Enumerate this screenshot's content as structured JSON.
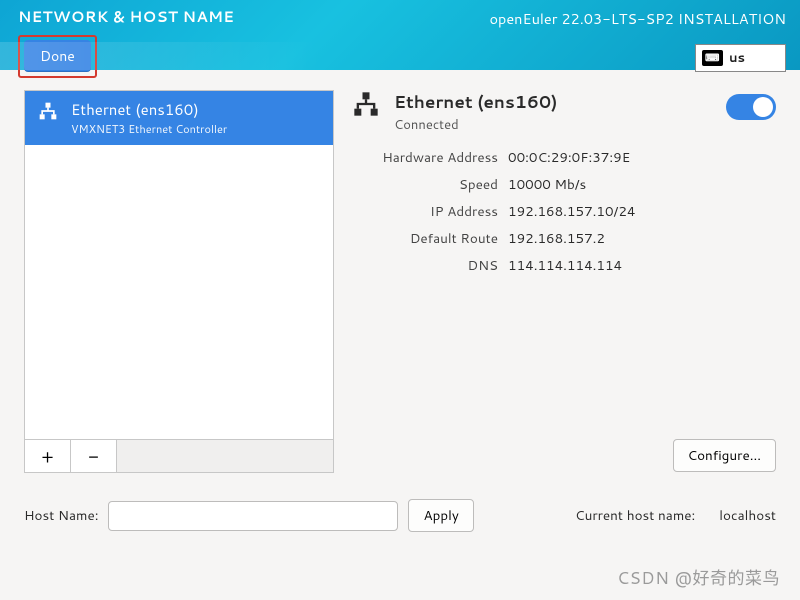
{
  "header": {
    "screen_title": "NETWORK & HOST NAME",
    "install_title": "openEuler 22.03-LTS-SP2 INSTALLATION",
    "done_label": "Done",
    "keyboard_layout": "us"
  },
  "devices": [
    {
      "name": "Ethernet (ens160)",
      "subtitle": "VMXNET3 Ethernet Controller"
    }
  ],
  "list_buttons": {
    "add": "+",
    "remove": "−"
  },
  "connection": {
    "title": "Ethernet (ens160)",
    "status": "Connected",
    "toggle_on": true
  },
  "details": {
    "labels": {
      "hwaddr": "Hardware Address",
      "speed": "Speed",
      "ip": "IP Address",
      "route": "Default Route",
      "dns": "DNS"
    },
    "values": {
      "hwaddr": "00:0C:29:0F:37:9E",
      "speed": "10000 Mb/s",
      "ip": "192.168.157.10/24",
      "route": "192.168.157.2",
      "dns": "114.114.114.114"
    }
  },
  "buttons": {
    "configure": "Configure...",
    "apply": "Apply"
  },
  "hostname": {
    "label": "Host Name:",
    "value": "",
    "current_label": "Current host name:",
    "current_value": "localhost"
  },
  "watermark": "CSDN @好奇的菜鸟"
}
